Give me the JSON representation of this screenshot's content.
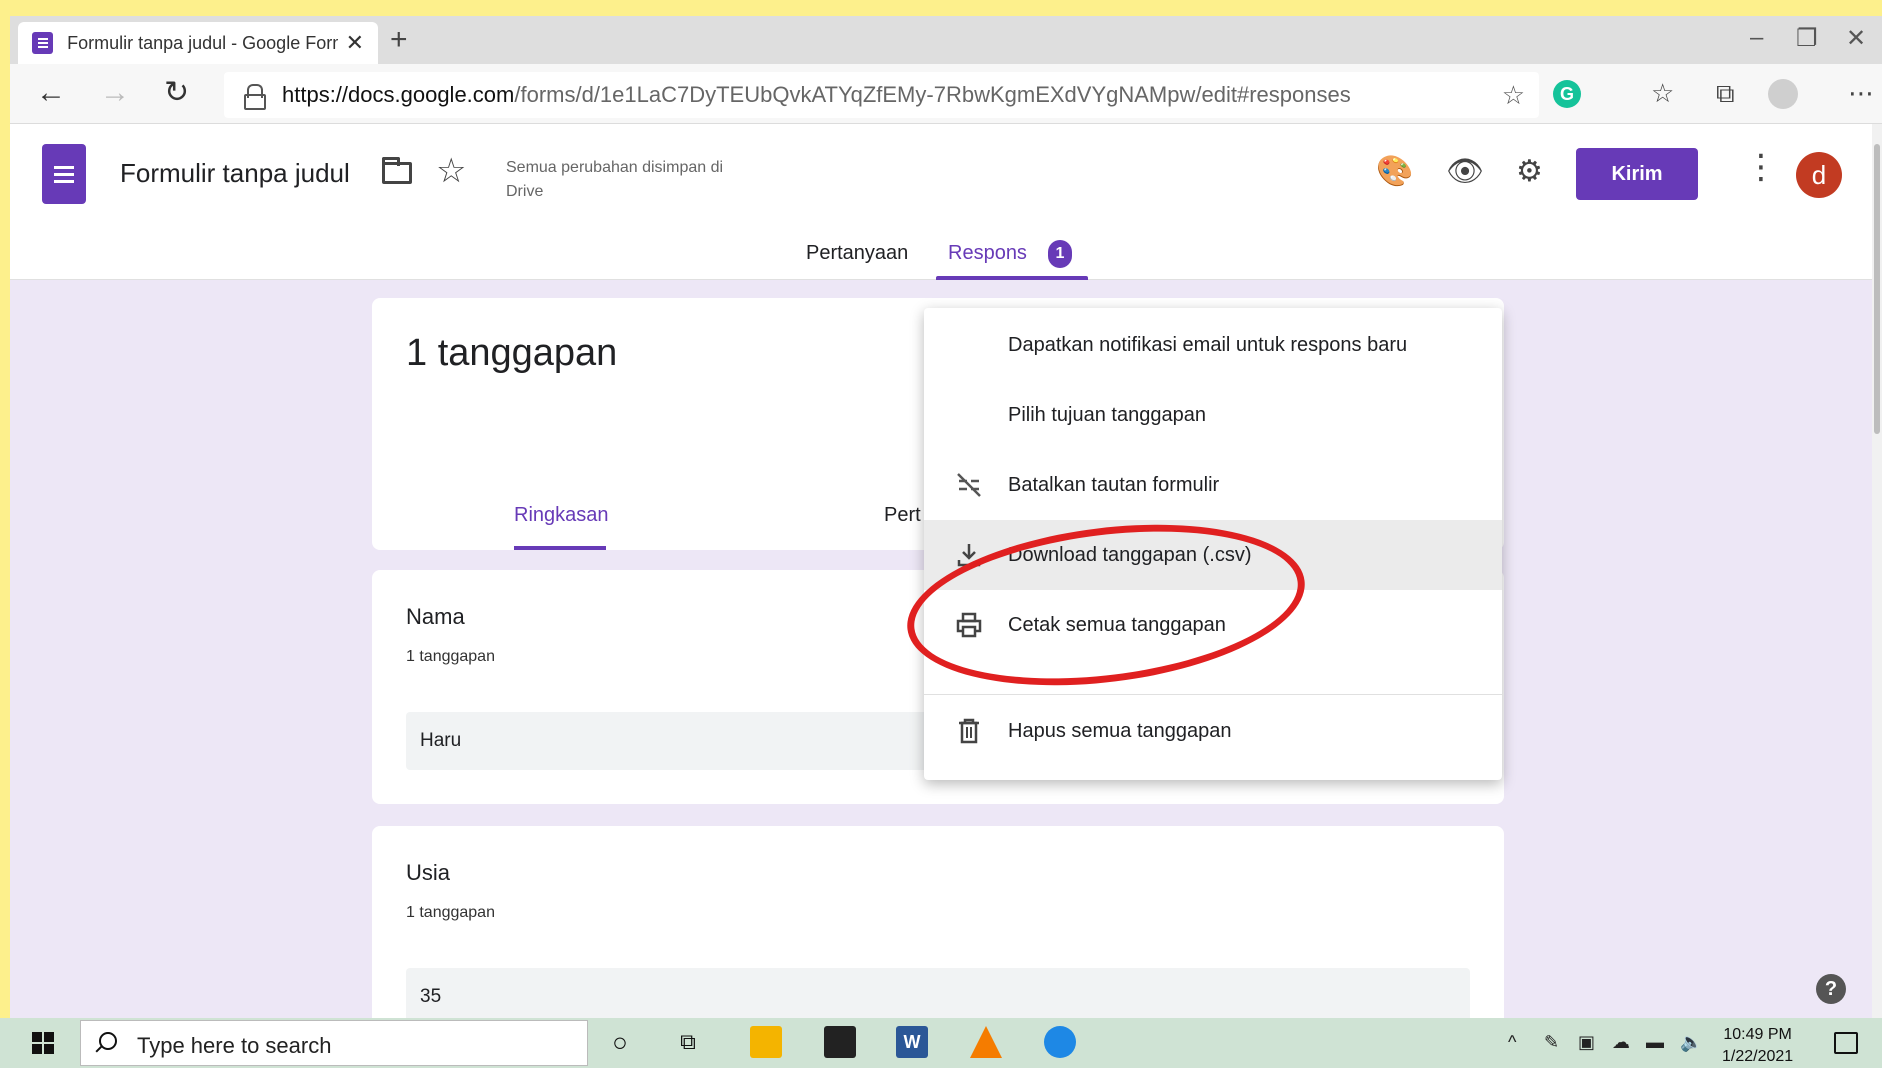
{
  "browser": {
    "tab_title": "Formulir tanpa judul - Google Forms",
    "url_host": "https://docs.google.com",
    "url_path": "/forms/d/1e1LaC7DyTEUbQvkATYqZfEMy-7RbwKgmEXdVYgNAMpw/edit#responses"
  },
  "header": {
    "form_title": "Formulir tanpa judul",
    "save_status": "Semua perubahan disimpan di Drive",
    "send_label": "Kirim",
    "avatar_letter": "d"
  },
  "tabs": {
    "questions": "Pertanyaan",
    "responses": "Respons",
    "responses_badge": "1"
  },
  "summary": {
    "count_title": "1 tanggapan",
    "tab_summary": "Ringkasan",
    "tab_question_partial": "Pert"
  },
  "questions": [
    {
      "title": "Nama",
      "count": "1 tanggapan",
      "answer": "Haru"
    },
    {
      "title": "Usia",
      "count": "1 tanggapan",
      "answer": "35"
    }
  ],
  "menu": {
    "items": [
      {
        "label": "Dapatkan notifikasi email untuk respons baru",
        "icon": "none"
      },
      {
        "label": "Pilih tujuan tanggapan",
        "icon": "none"
      },
      {
        "label": "Batalkan tautan formulir",
        "icon": "link-off-icon"
      },
      {
        "label": "Download tanggapan (.csv)",
        "icon": "download-icon"
      },
      {
        "label": "Cetak semua tanggapan",
        "icon": "print-icon"
      },
      {
        "label": "Hapus semua tanggapan",
        "icon": "trash-icon"
      }
    ],
    "highlighted_index": 3
  },
  "taskbar": {
    "search_placeholder": "Type here to search",
    "time": "10:49 PM",
    "date": "1/22/2021"
  },
  "colors": {
    "accent": "#673ab7",
    "background": "#ede7f6",
    "annotation": "#e02020",
    "page_border": "#fdf08c"
  }
}
